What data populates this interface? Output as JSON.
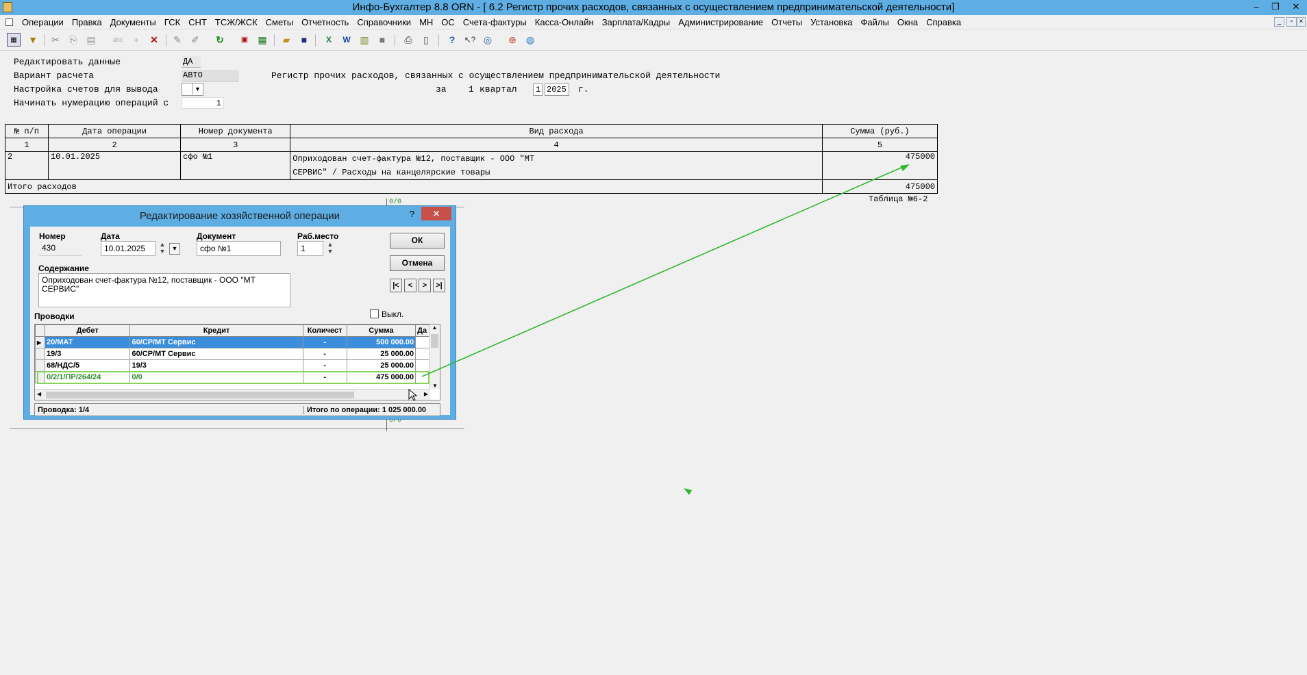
{
  "window": {
    "title": "Инфо-Бухгалтер 8.8   ORN   - [  6.2 Регистр прочих расходов, связанных с осуществлением предпринимательской деятельности]",
    "minimize": "–",
    "restore": "❐",
    "close": "✕"
  },
  "menu": [
    "Операции",
    "Правка",
    "Документы",
    "ГСК",
    "СНТ",
    "ТСЖ/ЖСК",
    "Сметы",
    "Отчетность",
    "Справочники",
    "МН",
    "ОС",
    "Счета-фактуры",
    "Касса-Онлайн",
    "Зарплата/Кадры",
    "Администрирование",
    "Отчеты",
    "Установка",
    "Файлы",
    "Окна",
    "Справка"
  ],
  "toolbar": {
    "icons": [
      "grid-icon",
      "filter-icon",
      "cut-icon",
      "copy-link-icon",
      "paste-icon",
      "abc-icon",
      "add-icon",
      "delete-icon",
      "edit-icon",
      "edit-off-icon",
      "refresh-icon",
      "pdf-icon",
      "calculator-icon",
      "open-icon",
      "save-icon",
      "excel-icon",
      "word-icon",
      "table-icon",
      "blank-icon",
      "print-icon",
      "page-icon",
      "help-icon",
      "help-pointer-icon",
      "compass-icon",
      "lifebuoy-icon",
      "globe-icon"
    ]
  },
  "report": {
    "edit_label": "Редактировать данные",
    "edit_value": "ДА",
    "calc_label": "Вариант расчета",
    "calc_value": "АВТО",
    "accounts_label": "Настройка счетов для вывода",
    "numbering_label": "Начинать нумерацию операций с",
    "numbering_value": "1",
    "heading": "Регистр прочих расходов, связанных с осуществлением предпринимательской деятельности",
    "period_prefix": "за",
    "period_quarter": "1",
    "period_quarter_label": "квартал",
    "period_quarter_field": "1",
    "period_year": "2025",
    "period_year_suffix": "г.",
    "table": {
      "headers": [
        "№ п/п",
        "Дата операции",
        "Номер документа",
        "Вид расхода",
        "Сумма (руб.)"
      ],
      "numbers": [
        "1",
        "2",
        "3",
        "4",
        "5"
      ],
      "row": {
        "n": "2",
        "date": "10.01.2025",
        "doc": "сфо №1",
        "kind_line1": "Оприходован счет-фактура №12, поставщик - ООО \"МТ",
        "kind_line2": "СЕРВИС\" / Расходы на канцелярские товары",
        "sum": "475000"
      },
      "total_label": "Итого расходов",
      "total_sum": "475000"
    },
    "table_caption": "Таблица №6-2"
  },
  "dialog": {
    "title": "Редактирование хозяйственной операции",
    "help": "?",
    "close": "✕",
    "number_label": "Номер",
    "number_value": "430",
    "date_label": "Дата",
    "date_value": "10.01.2025",
    "doc_label": "Документ",
    "doc_value": "сфо №1",
    "workplace_label": "Раб.место",
    "workplace_value": "1",
    "ok": "ОК",
    "cancel": "Отмена",
    "nav": [
      "|<",
      "<",
      ">",
      ">|"
    ],
    "content_label": "Содержание",
    "content_value": "Оприходован счет-фактура №12, поставщик - ООО \"МТ СЕРВИС\"",
    "postings_label": "Проводки",
    "off_label": "Выкл.",
    "grid_headers": [
      "Дебет",
      "Кредит",
      "Количест",
      "Сумма",
      "Да"
    ],
    "grid_rows": [
      {
        "debit": "20/МАТ",
        "credit": "60/СР/МТ Сервис",
        "qty": "-",
        "sum": "500 000.00"
      },
      {
        "debit": "19/3",
        "credit": "60/СР/МТ Сервис",
        "qty": "-",
        "sum": "25 000.00"
      },
      {
        "debit": "68/НДС/5",
        "credit": "19/3",
        "qty": "-",
        "sum": "25 000.00"
      },
      {
        "debit": "0/2/1/ПР/264/24",
        "credit": "0/0",
        "qty": "-",
        "sum": "475 000.00"
      }
    ],
    "status_posting": "Проводка: 1/4",
    "status_total": "Итого по операции: 1 025 000.00"
  },
  "colors": {
    "titlebar": "#5faee3",
    "selected_row": "#3b8edc",
    "highlight_green": "#2fb82f",
    "close_red": "#c7504b"
  },
  "background_fragments": [
    "0/0",
    "0/0"
  ]
}
